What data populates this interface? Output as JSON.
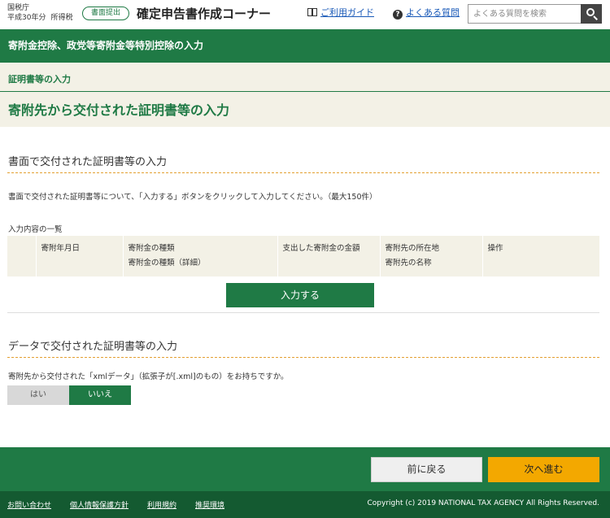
{
  "header": {
    "agency_line1": "国税庁",
    "agency_line2a": "平成30年分",
    "agency_line2b": "所得税",
    "submit_badge": "書面提出",
    "app_title": "確定申告書作成コーナー",
    "guide_link": "ご利用ガイド",
    "faq_link": "よくある質問",
    "search_placeholder": "よくある質問を検索",
    "guide_icon": "book-icon",
    "faq_icon": "question-circle-icon",
    "search_icon": "search-icon"
  },
  "section": {
    "title": "寄附金控除、政党等寄附金等特別控除の入力"
  },
  "sub": {
    "label": "証明書等の入力",
    "page_title": "寄附先から交付された証明書等の入力"
  },
  "paper": {
    "heading": "書面で交付された証明書等の入力",
    "description": "書面で交付された証明書等について、「入力する」ボタンをクリックして入力してください。（最大150件）",
    "list_label": "入力内容の一覧",
    "columns": {
      "date": "寄附年月日",
      "type": "寄附金の種類",
      "type_detail": "寄附金の種類（詳細）",
      "amount": "支出した寄附金の金額",
      "address": "寄附先の所在地",
      "name": "寄附先の名称",
      "action": "操作"
    },
    "add_button": "入力する"
  },
  "data_input": {
    "heading": "データで交付された証明書等の入力",
    "question": "寄附先から交付された「xmlデータ」（拡張子が[.xml]のもの）をお持ちですか。",
    "yes": "はい",
    "no": "いいえ"
  },
  "nav": {
    "back": "前に戻る",
    "next": "次へ進む"
  },
  "footer": {
    "contact": "お問い合わせ",
    "privacy": "個人情報保護方針",
    "terms": "利用規約",
    "env": "推奨環境",
    "copyright": "Copyright (c) 2019 NATIONAL TAX AGENCY All Rights Reserved."
  },
  "colors": {
    "brand_green": "#1f7a45",
    "dark_green": "#145a31",
    "beige": "#f3f1e6",
    "accent_orange": "#f3a800"
  }
}
